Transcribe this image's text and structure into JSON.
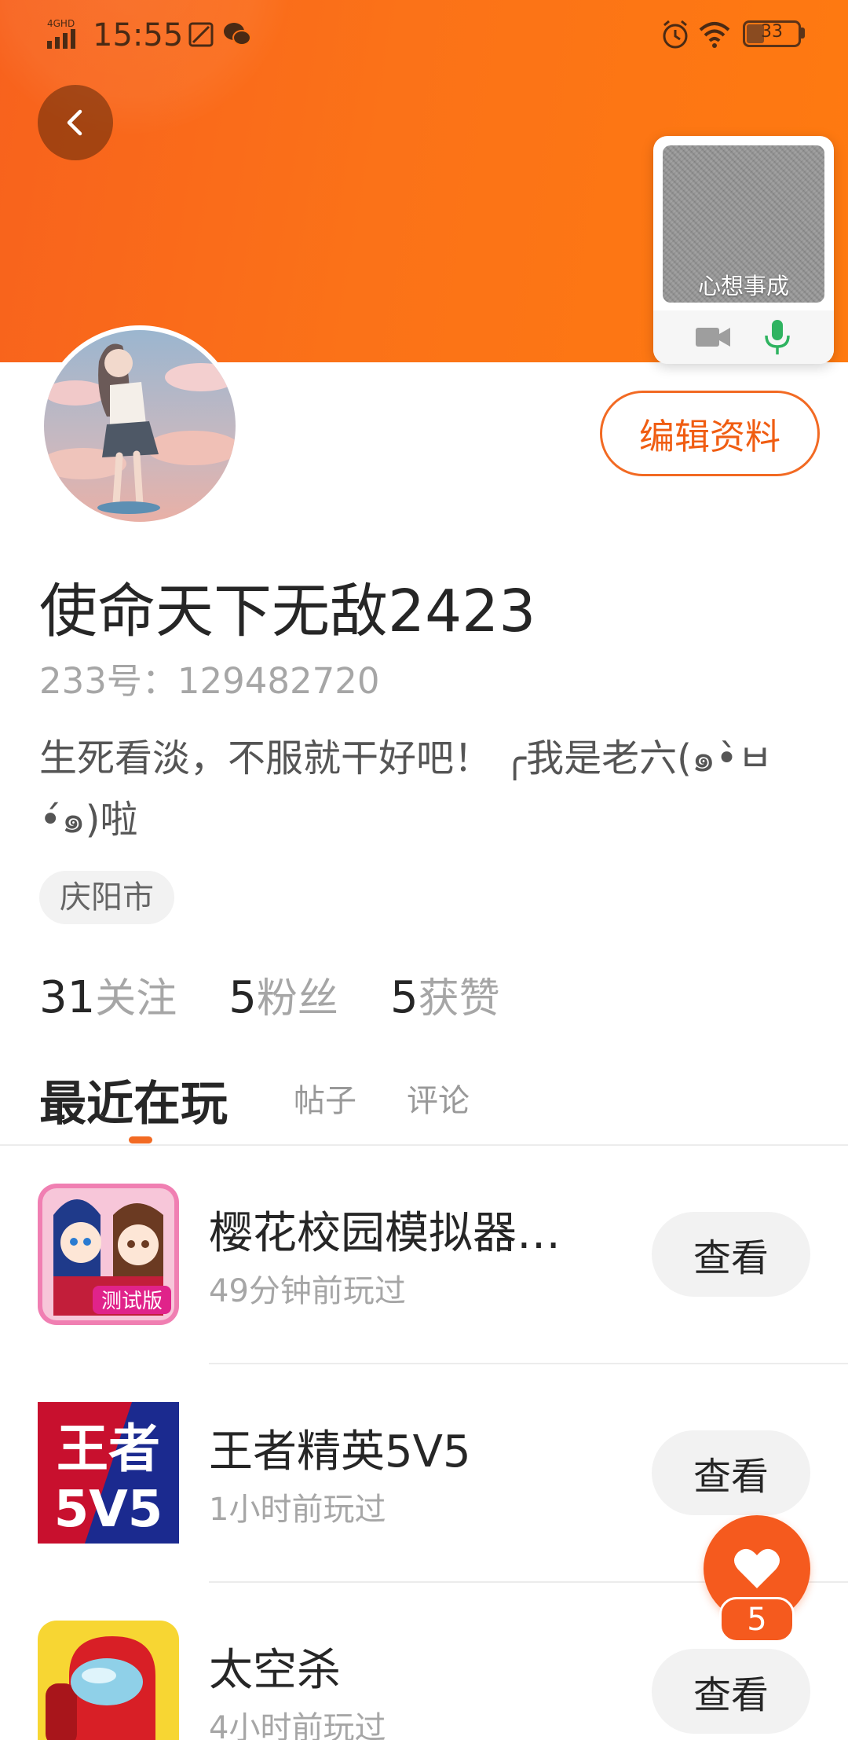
{
  "status_bar": {
    "network": "4GHD",
    "time": "15:55",
    "battery": "33"
  },
  "float_window": {
    "caption": "心想事成"
  },
  "profile": {
    "edit_label": "编辑资料",
    "username": "使命天下无敌2423",
    "user_id": "233号：129482720",
    "bio": "生死看淡，不服就干好吧！  ╭我是老六(๑•̀ㅂ•́๑)啦",
    "location": "庆阳市"
  },
  "stats": [
    {
      "num": "31",
      "label": "关注"
    },
    {
      "num": "5",
      "label": "粉丝"
    },
    {
      "num": "5",
      "label": "获赞"
    }
  ],
  "tabs": [
    {
      "label": "最近在玩",
      "active": true
    },
    {
      "label": "帖子",
      "active": false
    },
    {
      "label": "评论",
      "active": false
    }
  ],
  "games": [
    {
      "name": "樱花校园模拟器…",
      "time": "49分钟前玩过",
      "action": "查看",
      "icon": "sakura-school-icon",
      "icon_badge": "测试版"
    },
    {
      "name": "王者精英5V5",
      "time": "1小时前玩过",
      "action": "查看",
      "icon": "wangzhe-5v5-icon",
      "icon_text_top": "王者",
      "icon_text_bottom": "5V5"
    },
    {
      "name": "太空杀",
      "time": "4小时前玩过",
      "action": "查看",
      "icon": "space-kill-icon"
    }
  ],
  "like_fab": {
    "count": "5"
  },
  "colors": {
    "accent": "#f26a23",
    "banner": "#fb7218"
  }
}
